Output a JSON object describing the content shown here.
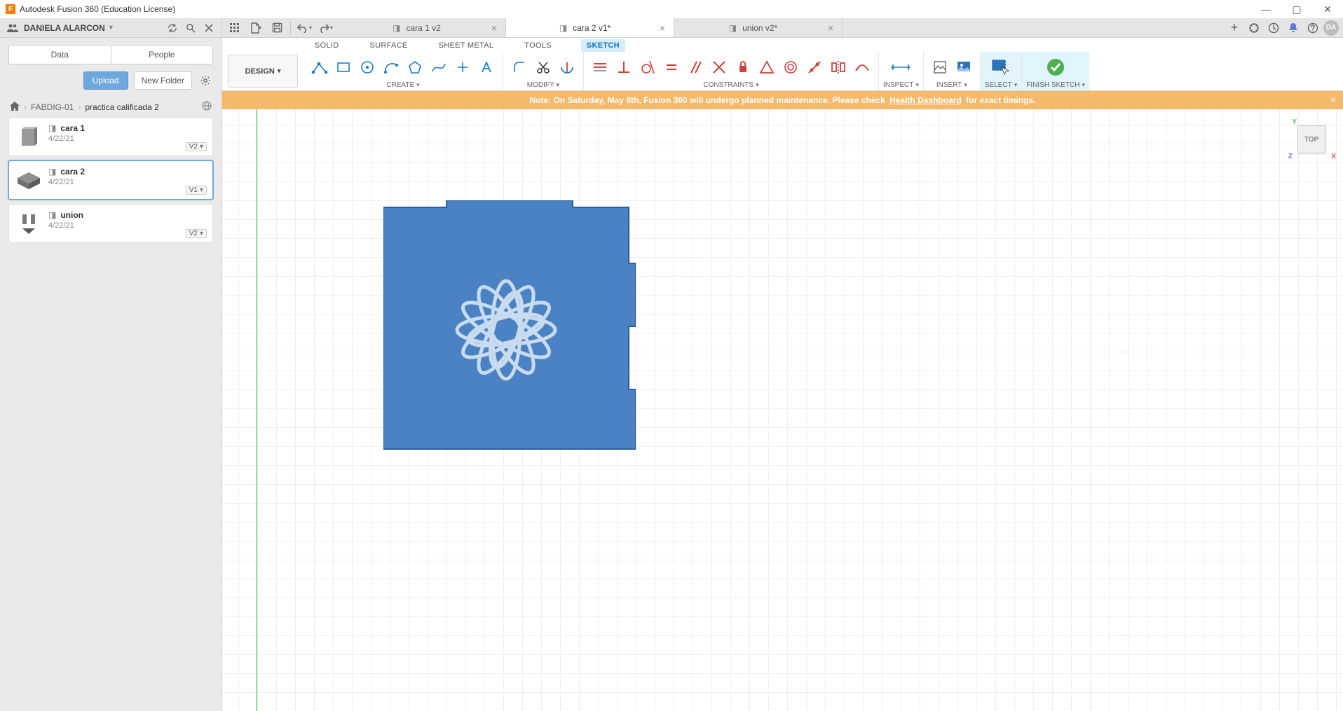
{
  "app": {
    "title": "Autodesk Fusion 360 (Education License)",
    "user": "DANIELA ALARCON",
    "avatar_initials": "DA"
  },
  "window_controls": {
    "min": "—",
    "max": "▢",
    "close": "✕"
  },
  "qat": {
    "grid_icon": "grid",
    "new_icon": "new",
    "save_icon": "save",
    "undo_icon": "undo",
    "redo_icon": "redo"
  },
  "doc_tabs": [
    {
      "name": "cara 1 v2",
      "active": false
    },
    {
      "name": "cara 2 v1*",
      "active": true
    },
    {
      "name": "union v2*",
      "active": false
    }
  ],
  "topright_icons": [
    "plus",
    "ext",
    "clock",
    "bell",
    "help"
  ],
  "sidebar": {
    "tabs": {
      "data": "Data",
      "people": "People",
      "active": "data"
    },
    "upload": "Upload",
    "new_folder": "New Folder",
    "breadcrumb": {
      "root": "FABDIG-01",
      "leaf": "practica calificada 2"
    },
    "files": [
      {
        "name": "cara 1",
        "date": "4/22/21",
        "version": "V2"
      },
      {
        "name": "cara 2",
        "date": "4/22/21",
        "version": "V1",
        "selected": true
      },
      {
        "name": "union",
        "date": "4/22/21",
        "version": "V2"
      }
    ]
  },
  "ribbon_tabs": [
    "SOLID",
    "SURFACE",
    "SHEET METAL",
    "TOOLS",
    "SKETCH"
  ],
  "ribbon_active": "SKETCH",
  "workspace": "DESIGN",
  "ribbon_groups": {
    "create": "CREATE",
    "modify": "MODIFY",
    "constraints": "CONSTRAINTS",
    "inspect": "INSPECT",
    "insert": "INSERT",
    "select": "SELECT",
    "finish": "FINISH SKETCH"
  },
  "notice": {
    "prefix": "Note: On Saturday, May 8th, Fusion 360 will undergo planned maintenance. Please check ",
    "link": "Health Dashboard",
    "suffix": " for exact timings."
  },
  "viewcube": {
    "face": "TOP",
    "y": "Y",
    "x": "X",
    "z": "Z"
  }
}
